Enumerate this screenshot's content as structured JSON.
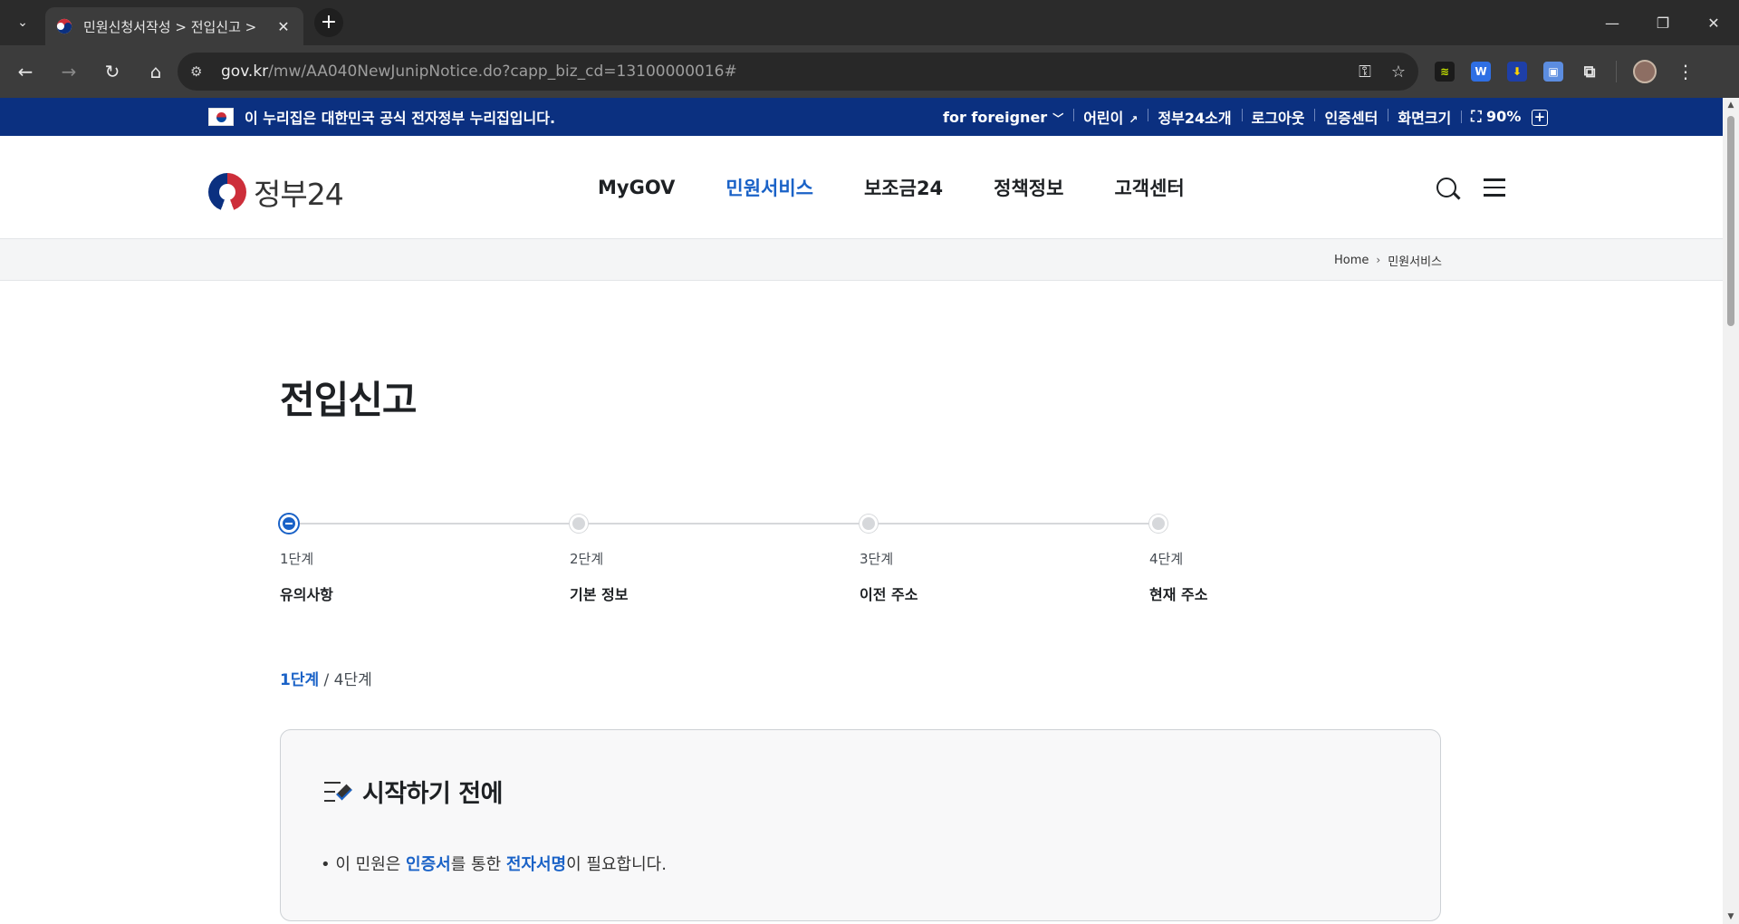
{
  "browser": {
    "tab_title": "민원신청서작성 > 전입신고 >",
    "url_host": "gov.kr",
    "url_path": "/mw/AA040NewJunipNotice.do?capp_biz_cd=13100000016#"
  },
  "banner": {
    "official_notice": "이 누리집은 대한민국 공식 전자정부 누리집입니다.",
    "foreigner": "for foreigner",
    "kids": "어린이",
    "about": "정부24소개",
    "logout": "로그아웃",
    "cert_center": "인증센터",
    "screen_size": "화면크기",
    "zoom_level": "90%"
  },
  "header": {
    "logo_text": "정부24",
    "nav": [
      "MyGOV",
      "민원서비스",
      "보조금24",
      "정책정보",
      "고객센터"
    ],
    "active_nav_index": 1
  },
  "breadcrumb": {
    "home": "Home",
    "current": "민원서비스"
  },
  "page": {
    "title": "전입신고"
  },
  "steps": [
    {
      "num": "1단계",
      "name": "유의사항"
    },
    {
      "num": "2단계",
      "name": "기본 정보"
    },
    {
      "num": "3단계",
      "name": "이전 주소"
    },
    {
      "num": "4단계",
      "name": "현재 주소"
    }
  ],
  "step_count": {
    "current": "1단계",
    "separator": "/",
    "total": "4단계"
  },
  "notice": {
    "title": "시작하기 전에",
    "bullet": "•",
    "text_1": "이 민원은 ",
    "hl_1": "인증서",
    "text_2": "를 통한 ",
    "hl_2": "전자서명",
    "text_3": "이 필요합니다."
  },
  "colors": {
    "primary": "#1a62c7",
    "banner_bg": "#0b3080"
  }
}
